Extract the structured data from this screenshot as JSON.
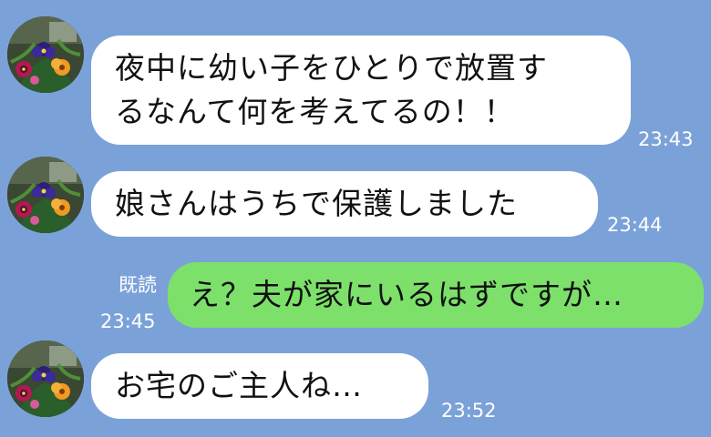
{
  "colors": {
    "background": "#7ba2d8",
    "incoming_bubble": "#ffffff",
    "outgoing_bubble": "#7ce06b",
    "meta_text": "#ffffff"
  },
  "avatar": {
    "icon": "flower-photo-avatar"
  },
  "messages": [
    {
      "direction": "incoming",
      "lines": [
        "夜中に幼い子をひとりで放置す",
        "るなんて何を考えてるの！！"
      ],
      "time": "23:43"
    },
    {
      "direction": "incoming",
      "lines": [
        "娘さんはうちで保護しました"
      ],
      "time": "23:44"
    },
    {
      "direction": "outgoing",
      "lines": [
        "え？夫が家にいるはずですが…"
      ],
      "read": "既読",
      "time": "23:45"
    },
    {
      "direction": "incoming",
      "lines": [
        "お宅のご主人ね…"
      ],
      "time": "23:52"
    }
  ]
}
